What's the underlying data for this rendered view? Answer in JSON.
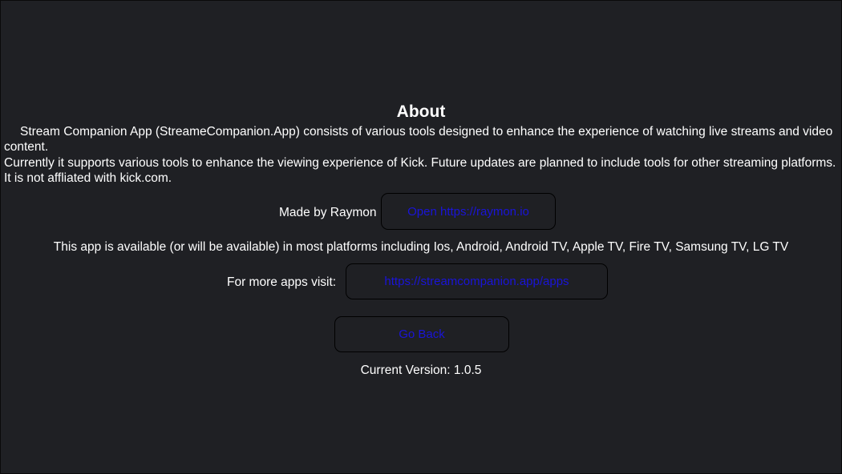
{
  "about": {
    "title": "About",
    "paragraph1": "Stream Companion App (StreameCompanion.App) consists of various tools designed to enhance the experience of watching live streams and video content.",
    "paragraph2": "Currently it supports various tools to enhance the viewing experience of Kick. Future updates are planned to include tools for other streaming platforms.  It is not affliated with kick.com."
  },
  "made_by": {
    "label": "Made by Raymon",
    "button_label": "Open https://raymon.io"
  },
  "platforms_text": "This app is available (or will be available) in most platforms including Ios, Android, Android TV, Apple TV, Fire TV,  Samsung TV, LG TV",
  "more_apps": {
    "label": "For more apps visit:",
    "button_label": "https://streamcompanion.app/apps"
  },
  "go_back_label": "Go Back",
  "version_text": "Current Version: 1.0.5",
  "colors": {
    "background": "#1f2024",
    "text": "#ffffff",
    "button_text": "#1a14d8",
    "button_border": "#000000"
  }
}
